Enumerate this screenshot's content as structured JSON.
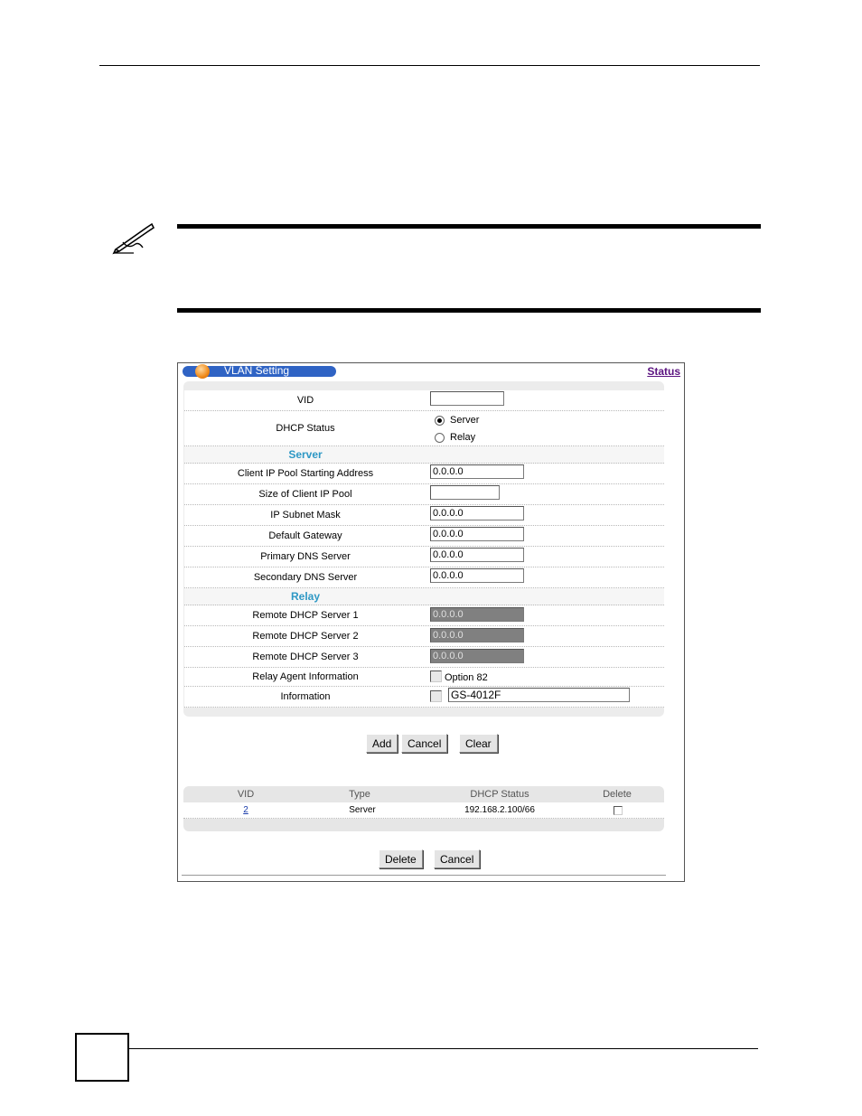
{
  "window": {
    "title": "VLAN Setting",
    "status_link": "Status"
  },
  "form": {
    "vid_label": "VID",
    "vid_value": "",
    "dhcp_status_label": "DHCP Status",
    "dhcp_options": [
      {
        "label": "Server",
        "checked": true
      },
      {
        "label": "Relay",
        "checked": false
      }
    ],
    "server_section": "Server",
    "server_fields": [
      {
        "label": "Client IP Pool Starting Address",
        "value": "0.0.0.0"
      },
      {
        "label": "Size of Client IP Pool",
        "value": ""
      },
      {
        "label": "IP Subnet Mask",
        "value": "0.0.0.0"
      },
      {
        "label": "Default Gateway",
        "value": "0.0.0.0"
      },
      {
        "label": "Primary DNS Server",
        "value": "0.0.0.0"
      },
      {
        "label": "Secondary DNS Server",
        "value": "0.0.0.0"
      }
    ],
    "relay_section": "Relay",
    "relay_fields": [
      {
        "label": "Remote DHCP Server 1",
        "value": "0.0.0.0"
      },
      {
        "label": "Remote DHCP Server 2",
        "value": "0.0.0.0"
      },
      {
        "label": "Remote DHCP Server 3",
        "value": "0.0.0.0"
      }
    ],
    "relay_agent_label": "Relay Agent Information",
    "relay_agent_option": "Option 82",
    "information_label": "Information",
    "information_value": "GS-4012F"
  },
  "buttons": {
    "add": "Add",
    "cancel": "Cancel",
    "clear": "Clear",
    "delete": "Delete",
    "cancel2": "Cancel"
  },
  "table": {
    "headers": [
      "VID",
      "Type",
      "DHCP Status",
      "Delete"
    ],
    "rows": [
      {
        "vid": "2",
        "type": "Server",
        "dhcp_status": "192.168.2.100/66"
      }
    ]
  }
}
